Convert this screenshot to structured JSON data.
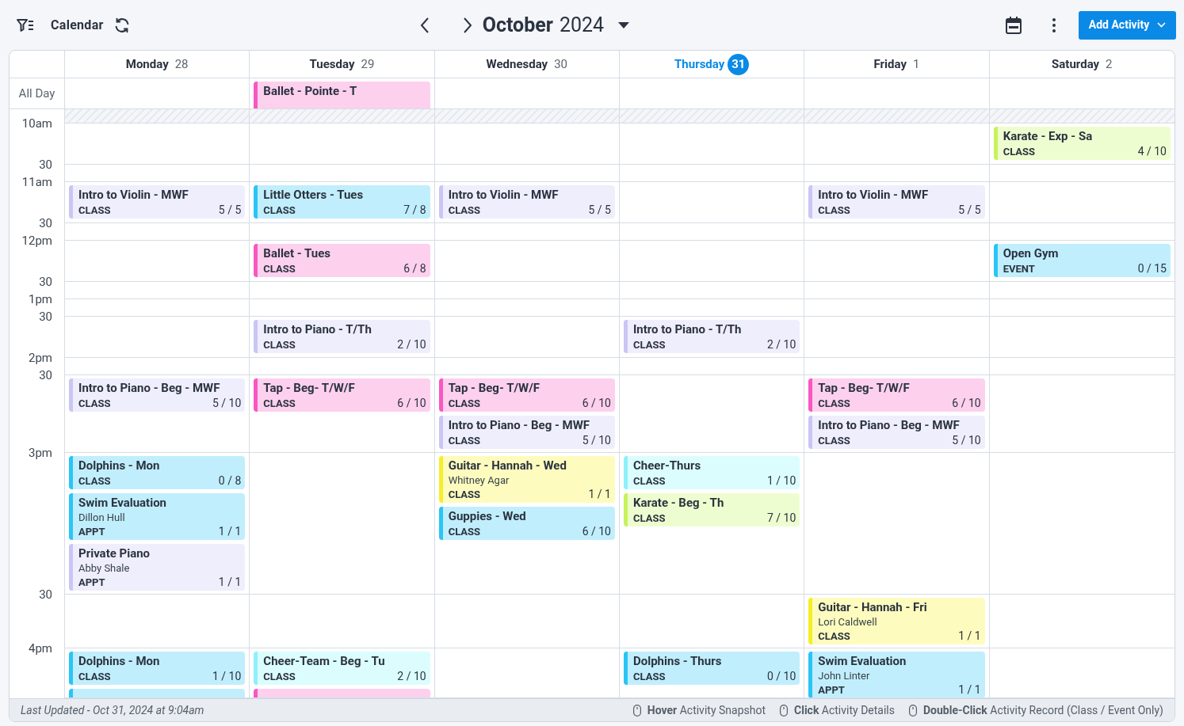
{
  "toolbar": {
    "title": "Calendar",
    "month": "October",
    "year": "2024",
    "add_button": "Add Activity"
  },
  "all_day_label": "All Day",
  "days": [
    {
      "name": "Monday",
      "date": "28",
      "today": false
    },
    {
      "name": "Tuesday",
      "date": "29",
      "today": false,
      "all_day_events": [
        {
          "title": "Ballet - Pointe - T",
          "color": "#f857c1"
        }
      ]
    },
    {
      "name": "Wednesday",
      "date": "30",
      "today": false
    },
    {
      "name": "Thursday",
      "date": "31",
      "today": true
    },
    {
      "name": "Friday",
      "date": "1",
      "today": false
    },
    {
      "name": "Saturday",
      "date": "2",
      "today": false
    }
  ],
  "time_slots": [
    {
      "label": "10am",
      "cells": [
        {},
        {},
        {},
        {},
        {},
        {
          "events": [
            {
              "title": "Karate - Exp - Sa",
              "type": "CLASS",
              "count": "4 / 10",
              "color": "#c8f25a"
            }
          ]
        }
      ]
    },
    {
      "label": "30",
      "cells": [
        {},
        {},
        {},
        {},
        {},
        {}
      ]
    },
    {
      "label": "11am",
      "cells": [
        {
          "events": [
            {
              "title": "Intro to Violin - MWF",
              "type": "CLASS",
              "count": "5 / 5",
              "color": "#c9c6f5"
            }
          ]
        },
        {
          "events": [
            {
              "title": "Little Otters - Tues",
              "type": "CLASS",
              "count": "7 / 8",
              "color": "#29c5f6"
            }
          ]
        },
        {
          "events": [
            {
              "title": "Intro to Violin - MWF",
              "type": "CLASS",
              "count": "5 / 5",
              "color": "#c9c6f5"
            }
          ]
        },
        {},
        {
          "events": [
            {
              "title": "Intro to Violin - MWF",
              "type": "CLASS",
              "count": "5 / 5",
              "color": "#c9c6f5"
            }
          ]
        },
        {}
      ]
    },
    {
      "label": "30",
      "cells": [
        {},
        {},
        {},
        {},
        {},
        {}
      ]
    },
    {
      "label": "12pm",
      "cells": [
        {},
        {
          "events": [
            {
              "title": "Ballet - Tues",
              "type": "CLASS",
              "count": "6 / 8",
              "color": "#f857c1"
            }
          ]
        },
        {},
        {},
        {},
        {
          "events": [
            {
              "title": "Open Gym",
              "type": "EVENT",
              "count": "0 / 15",
              "color": "#29c5f6"
            }
          ]
        }
      ]
    },
    {
      "label": "30",
      "cells": [
        {},
        {},
        {},
        {},
        {},
        {}
      ]
    },
    {
      "label": "1pm",
      "cells": [
        {},
        {},
        {},
        {},
        {},
        {}
      ]
    },
    {
      "label": "30",
      "cells": [
        {},
        {
          "events": [
            {
              "title": "Intro to Piano - T/Th",
              "type": "CLASS",
              "count": "2 / 10",
              "color": "#c9c6f5"
            }
          ]
        },
        {},
        {
          "events": [
            {
              "title": "Intro to Piano - T/Th",
              "type": "CLASS",
              "count": "2 / 10",
              "color": "#c9c6f5"
            }
          ]
        },
        {},
        {}
      ]
    },
    {
      "label": "2pm",
      "cells": [
        {},
        {},
        {},
        {},
        {},
        {}
      ]
    },
    {
      "label": "30",
      "cells": [
        {
          "events": [
            {
              "title": "Intro to Piano - Beg - MWF",
              "type": "CLASS",
              "count": "5 / 10",
              "color": "#c9c6f5"
            }
          ]
        },
        {
          "events": [
            {
              "title": "Tap - Beg- T/W/F",
              "type": "CLASS",
              "count": "6 / 10",
              "color": "#f857c1"
            }
          ]
        },
        {
          "events": [
            {
              "title": "Tap - Beg- T/W/F",
              "type": "CLASS",
              "count": "6 / 10",
              "color": "#f857c1"
            },
            {
              "title": "Intro to Piano - Beg - MWF",
              "type": "CLASS",
              "count": "5 / 10",
              "color": "#c9c6f5"
            }
          ]
        },
        {},
        {
          "events": [
            {
              "title": "Tap - Beg- T/W/F",
              "type": "CLASS",
              "count": "6 / 10",
              "color": "#f857c1"
            },
            {
              "title": "Intro to Piano - Beg - MWF",
              "type": "CLASS",
              "count": "5 / 10",
              "color": "#c9c6f5"
            }
          ]
        },
        {}
      ]
    },
    {
      "label": "3pm",
      "cells": [
        {
          "events": [
            {
              "title": "Dolphins - Mon",
              "type": "CLASS",
              "count": "0 / 8",
              "color": "#29c5f6"
            },
            {
              "title": "Swim Evaluation",
              "person": "Dillon Hull",
              "type": "APPT",
              "count": "1 / 1",
              "color": "#29c5f6"
            },
            {
              "title": "Private Piano",
              "person": "Abby Shale",
              "type": "APPT",
              "count": "1 / 1",
              "color": "#c9c6f5"
            }
          ]
        },
        {},
        {
          "events": [
            {
              "title": "Guitar - Hannah - Wed",
              "person": "Whitney Agar",
              "type": "CLASS",
              "count": "1 / 1",
              "color": "#f5ee2a"
            },
            {
              "title": "Guppies - Wed",
              "type": "CLASS",
              "count": "6 / 10",
              "color": "#29c5f6"
            }
          ]
        },
        {
          "events": [
            {
              "title": "Cheer-Thurs",
              "type": "CLASS",
              "count": "1 / 10",
              "color": "#8ef0fb"
            },
            {
              "title": "Karate - Beg - Th",
              "type": "CLASS",
              "count": "7 / 10",
              "color": "#c8f25a"
            }
          ]
        },
        {},
        {}
      ]
    },
    {
      "label": "30",
      "cells": [
        {},
        {},
        {},
        {},
        {
          "events": [
            {
              "title": "Guitar - Hannah - Fri",
              "person": "Lori Caldwell",
              "type": "CLASS",
              "count": "1 / 1",
              "color": "#f5ee2a"
            }
          ]
        },
        {}
      ]
    },
    {
      "label": "4pm",
      "cells": [
        {
          "events": [
            {
              "title": "Dolphins - Mon",
              "type": "CLASS",
              "count": "1 / 10",
              "color": "#29c5f6"
            },
            {
              "color": "#29c5f6"
            }
          ]
        },
        {
          "events": [
            {
              "title": "Cheer-Team - Beg - Tu",
              "type": "CLASS",
              "count": "2 / 10",
              "color": "#8ef0fb"
            },
            {
              "color": "#f857c1"
            }
          ]
        },
        {},
        {
          "events": [
            {
              "title": "Dolphins - Thurs",
              "type": "CLASS",
              "count": "0 / 10",
              "color": "#29c5f6"
            }
          ]
        },
        {
          "events": [
            {
              "title": "Swim Evaluation",
              "person": "John Linter",
              "type": "APPT",
              "count": "1 / 1",
              "color": "#29c5f6"
            }
          ]
        },
        {}
      ]
    }
  ],
  "footer": {
    "updated": "Last Updated - Oct 31, 2024 at 9:04am",
    "hints": [
      "**Hover** Activity Snapshot",
      "**Click** Activity Details",
      "**Double-Click** Activity Record (Class / Event Only)"
    ]
  }
}
